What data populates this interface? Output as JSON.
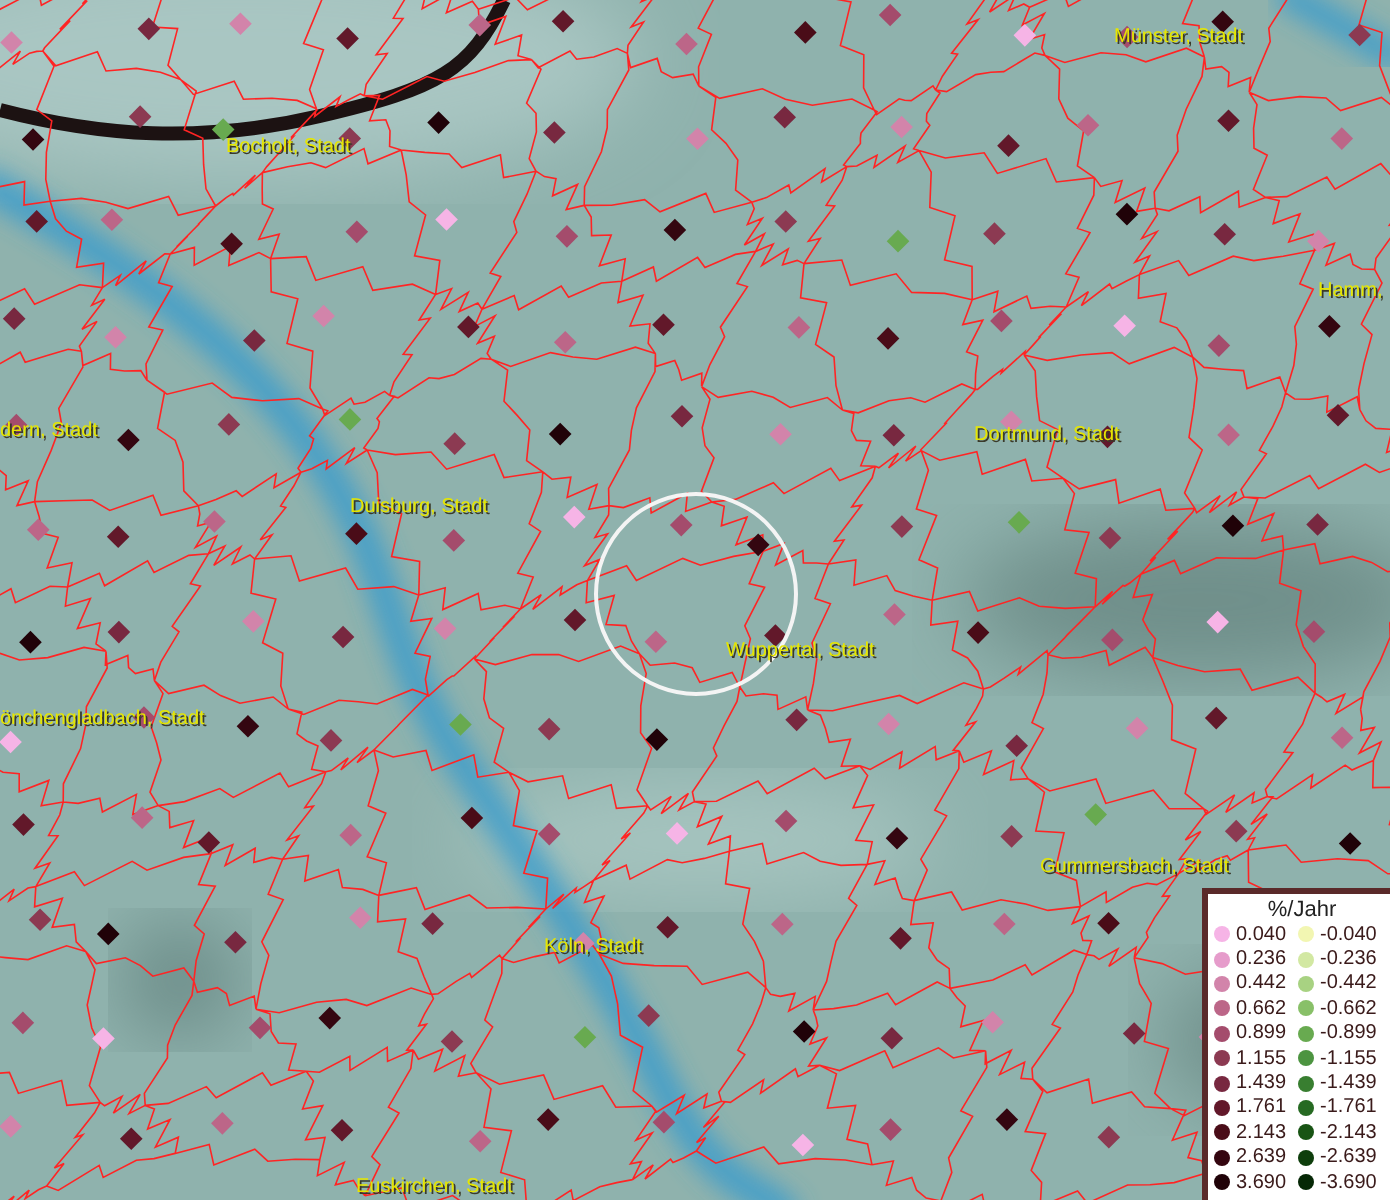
{
  "map": {
    "places": [
      {
        "name": "Münster, Stadt"
      },
      {
        "name": "Bocholt, Stadt"
      },
      {
        "name": "Hamm,"
      },
      {
        "name": "dern, Stadt"
      },
      {
        "name": "Dortmund, Stadt"
      },
      {
        "name": "Duisburg, Stadt"
      },
      {
        "name": "Wuppertal, Stadt"
      },
      {
        "name": "önchengladbach, Stadt"
      },
      {
        "name": "Gummersbach, Stadt"
      },
      {
        "name": "Köln, Stadt"
      },
      {
        "name": "Euskirchen, Stadt"
      }
    ]
  },
  "legend": {
    "title": "%/Jahr",
    "positive": [
      {
        "label": "0.040",
        "color": "#f6b4e6"
      },
      {
        "label": "0.236",
        "color": "#e69ccb"
      },
      {
        "label": "0.442",
        "color": "#d284aa"
      },
      {
        "label": "0.662",
        "color": "#bc6688"
      },
      {
        "label": "0.899",
        "color": "#a44c6c"
      },
      {
        "label": "1.155",
        "color": "#8c3a52"
      },
      {
        "label": "1.439",
        "color": "#782840"
      },
      {
        "label": "1.761",
        "color": "#62182a"
      },
      {
        "label": "2.143",
        "color": "#4a0c18"
      },
      {
        "label": "2.639",
        "color": "#340610"
      },
      {
        "label": "3.690",
        "color": "#200208"
      }
    ],
    "negative": [
      {
        "label": "-0.040",
        "color": "#f2f6b2"
      },
      {
        "label": "-0.236",
        "color": "#d2e8a2"
      },
      {
        "label": "-0.442",
        "color": "#a8d282"
      },
      {
        "label": "-0.662",
        "color": "#88c068"
      },
      {
        "label": "-0.899",
        "color": "#68aa50"
      },
      {
        "label": "-1.155",
        "color": "#4c9440"
      },
      {
        "label": "-1.439",
        "color": "#387e30"
      },
      {
        "label": "-1.761",
        "color": "#266a22"
      },
      {
        "label": "-2.143",
        "color": "#185414"
      },
      {
        "label": "-2.639",
        "color": "#0e3e0c"
      },
      {
        "label": "-3.690",
        "color": "#062806"
      }
    ]
  }
}
